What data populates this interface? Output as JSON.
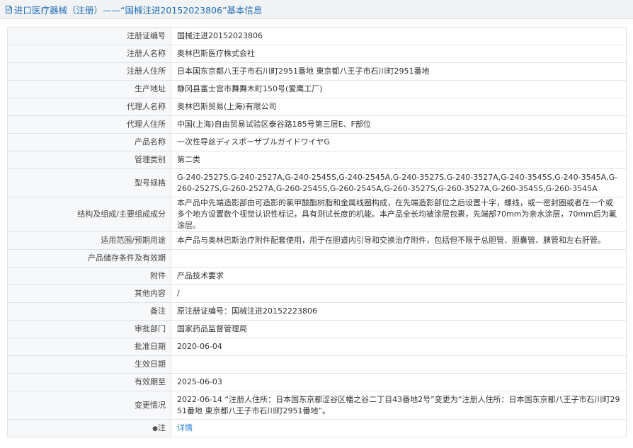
{
  "header": {
    "title": "进口医疗器械（注册）——“国械注进20152023806”基本信息"
  },
  "rows": [
    {
      "label": "注册证编号",
      "value": "国械注进20152023806",
      "h": 25
    },
    {
      "label": "注册人名称",
      "value": "奥林巴斯医疗株式会社",
      "h": 25
    },
    {
      "label": "注册人住所",
      "value": "日本国东京都八王子市石川町2951番地 東京都八王子市石川町2951番地",
      "h": 25
    },
    {
      "label": "生产地址",
      "value": "静冈县富士宫市舞舞木町150号(爱鹰工厂)",
      "h": 25
    },
    {
      "label": "代理人名称",
      "value": "奥林巴斯贸易(上海)有限公司",
      "h": 25
    },
    {
      "label": "代理人住所",
      "value": "中国(上海)自由贸易试验区泰谷路185号第三层E、F部位",
      "h": 25
    },
    {
      "label": "产品名称",
      "value": "一次性导丝ディスポーザブルガイドワイヤG",
      "h": 25
    },
    {
      "label": "管理类别",
      "value": "第二类",
      "h": 25
    },
    {
      "label": "型号规格",
      "value": "G-240-2527S,G-240-2527A,G-240-2545S,G-240-2545A,G-240-3527S,G-240-3527A,G-240-3545S,G-240-3545A,G-260-2527S,G-260-2527A,G-260-2545S,G-260-2545A,G-260-3527S,G-260-3527A,G-260-3545S,G-260-3545A",
      "h": 40
    },
    {
      "label": "结构及组成/主要组成成分",
      "value": "本产品中先端造影部由可造影的氯甲酸酯树脂和金属线圈构成，在先端造影部位之后设置十字，螺线，或一密封圈或者在一个或多个地方设置数个视觉认识性标记，具有测试长度的机能。本产品全长均被涂层包裹，先端部70mm为亲水涂层，70mm后为氟涂层。",
      "h": 40
    },
    {
      "label": "适用范围/预期用途",
      "value": "本产品与奥林巴斯治疗附件配套使用，用于在胆道内引导和交换治疗附件，包括但不限于总胆管、胆囊管、胰管和左右肝管。",
      "h": 25
    },
    {
      "label": "产品储存条件及有效期",
      "value": "",
      "h": 25
    },
    {
      "label": "附件",
      "value": "产品技术要求",
      "h": 25
    },
    {
      "label": "其他内容",
      "value": "/",
      "h": 25
    },
    {
      "label": "备注",
      "value": "原注册证编号：国械注进20152223806",
      "h": 25
    },
    {
      "label": "审批部门",
      "value": "国家药品监督管理局",
      "h": 25
    },
    {
      "label": "批准日期",
      "value": "2020-06-04",
      "h": 25
    },
    {
      "label": "生效日期",
      "value": "",
      "h": 25
    },
    {
      "label": "有效期至",
      "value": "2025-06-03",
      "h": 25
    },
    {
      "label": "变更情况",
      "value": "2022-06-14 “注册人住所：日本国东京都涩谷区幡之谷二丁目43番地2号”变更为“注册人住所：日本国东京都八王子市石川町2951番地 東京都八王子市石川町2951番地”。",
      "h": 40
    }
  ],
  "detail_row": {
    "label": "注",
    "value": "详情",
    "icon": "pin-icon"
  }
}
